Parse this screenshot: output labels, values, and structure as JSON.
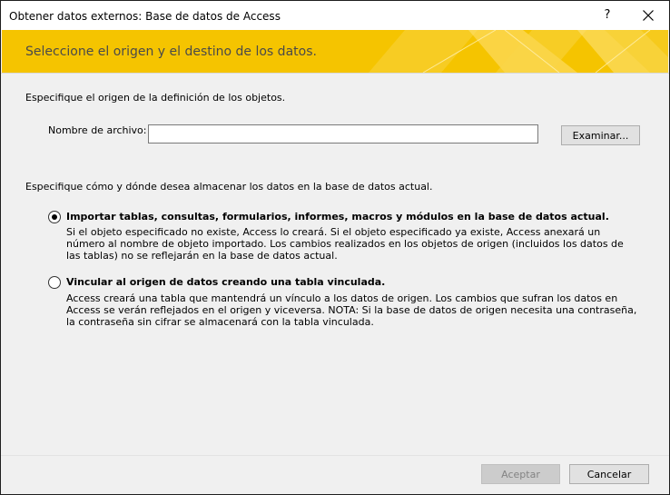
{
  "window": {
    "title": "Obtener datos externos: Base de datos de Access",
    "help_label": "?"
  },
  "banner": {
    "heading": "Seleccione el origen y el destino de los datos."
  },
  "source": {
    "instruction": "Especifique el origen de la definición de los objetos.",
    "file_label": "Nombre de archivo:",
    "file_value": "",
    "browse_label": "Examinar..."
  },
  "storage": {
    "instruction": "Especifique cómo y dónde desea almacenar los datos en la base de datos actual.",
    "options": [
      {
        "label": "Importar tablas, consultas, formularios, informes, macros y módulos en la base de datos actual.",
        "description": "Si el objeto especificado no existe, Access lo creará. Si el objeto especificado ya existe, Access anexará un número al nombre de objeto importado. Los cambios realizados en los objetos de origen (incluidos los datos de las tablas) no se reflejarán en la base de datos actual.",
        "selected": true
      },
      {
        "label": "Vincular al origen de datos creando una tabla vinculada.",
        "description": "Access creará una tabla que mantendrá un vínculo a los datos de origen. Los cambios que sufran los datos en Access se verán reflejados en el origen y viceversa. NOTA: Si la base de datos de origen necesita una contraseña, la contraseña sin cifrar se almacenará con la tabla vinculada.",
        "selected": false
      }
    ]
  },
  "footer": {
    "accept_label": "Aceptar",
    "accept_enabled": false,
    "cancel_label": "Cancelar"
  },
  "colors": {
    "banner": "#f5c400",
    "banner_text": "#4a4a4a",
    "dialog_bg": "#f0f0f0"
  }
}
